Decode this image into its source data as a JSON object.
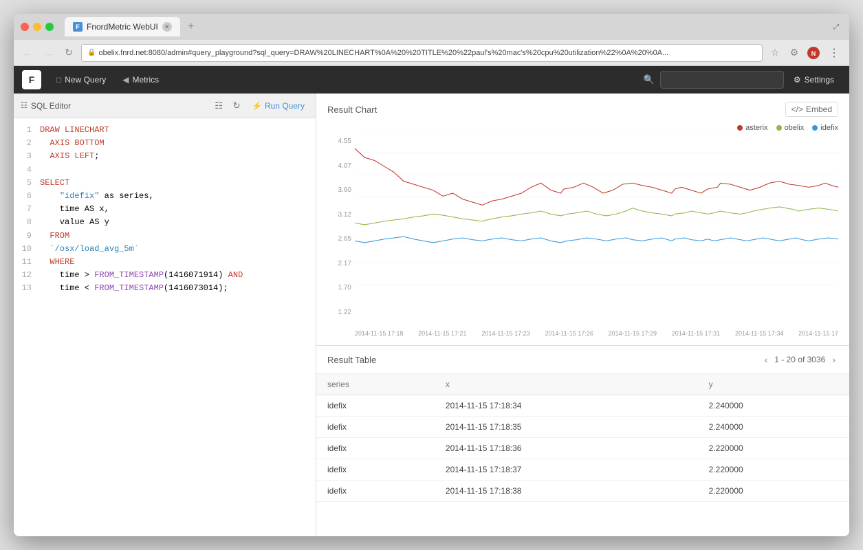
{
  "browser": {
    "tab_title": "FnordMetric WebUI",
    "url": "obelix.fnrd.net:8080/admin#query_playground?sql_query=DRAW%20LINECHART%0A%20%20TITLE%20%22paul's%20mac's%20cpu%20utilization%22%0A%20%0A...",
    "back_btn": "←",
    "forward_btn": "→",
    "refresh_btn": "↻"
  },
  "app": {
    "logo": "F",
    "new_query_label": "New Query",
    "metrics_label": "Metrics",
    "search_placeholder": "",
    "settings_label": "Settings"
  },
  "editor": {
    "label": "SQL Editor",
    "run_label": "Run Query",
    "lines": [
      {
        "num": 1,
        "code": "DRAW LINECHART",
        "type": "draw"
      },
      {
        "num": 2,
        "code": "  AXIS BOTTOM",
        "type": "axis"
      },
      {
        "num": 3,
        "code": "  AXIS LEFT;",
        "type": "axis"
      },
      {
        "num": 4,
        "code": "",
        "type": "plain"
      },
      {
        "num": 5,
        "code": "SELECT",
        "type": "select"
      },
      {
        "num": 6,
        "code": "    \"idefix\" as series,",
        "type": "str"
      },
      {
        "num": 7,
        "code": "    time AS x,",
        "type": "plain"
      },
      {
        "num": 8,
        "code": "    value AS y",
        "type": "plain"
      },
      {
        "num": 9,
        "code": "  FROM",
        "type": "from"
      },
      {
        "num": 10,
        "code": "  `/osx/load_avg_5m`",
        "type": "plain"
      },
      {
        "num": 11,
        "code": "  WHERE",
        "type": "where"
      },
      {
        "num": 12,
        "code": "    time > FROM_TIMESTAMP(1416071914) AND",
        "type": "plain"
      },
      {
        "num": 13,
        "code": "    time < FROM_TIMESTAMP(1416073014);",
        "type": "plain"
      }
    ]
  },
  "chart": {
    "title": "Result Chart",
    "embed_label": "Embed",
    "legend": [
      {
        "name": "asterix",
        "color": "#c0392b"
      },
      {
        "name": "obelix",
        "color": "#8db843"
      },
      {
        "name": "idefix",
        "color": "#3498db"
      }
    ],
    "y_axis": [
      "4.55",
      "4.07",
      "3.60",
      "3.12",
      "2.65",
      "2.17",
      "1.70",
      "1.22"
    ],
    "x_axis": [
      "2014-11-15 17:18",
      "2014-11-15 17:21",
      "2014-11-15 17:23",
      "2014-11-15 17:26",
      "2014-11-15 17:29",
      "2014-11-15 17:31",
      "2014-11-15 17:34",
      "2014-11-15 17"
    ]
  },
  "table": {
    "title": "Result Table",
    "pagination": "1 - 20 of 3036",
    "columns": [
      "series",
      "x",
      "y"
    ],
    "rows": [
      {
        "series": "idefix",
        "x": "2014-11-15 17:18:34",
        "y": "2.240000"
      },
      {
        "series": "idefix",
        "x": "2014-11-15 17:18:35",
        "y": "2.240000"
      },
      {
        "series": "idefix",
        "x": "2014-11-15 17:18:36",
        "y": "2.220000"
      },
      {
        "series": "idefix",
        "x": "2014-11-15 17:18:37",
        "y": "2.220000"
      },
      {
        "series": "idefix",
        "x": "2014-11-15 17:18:38",
        "y": "2.220000"
      }
    ]
  }
}
